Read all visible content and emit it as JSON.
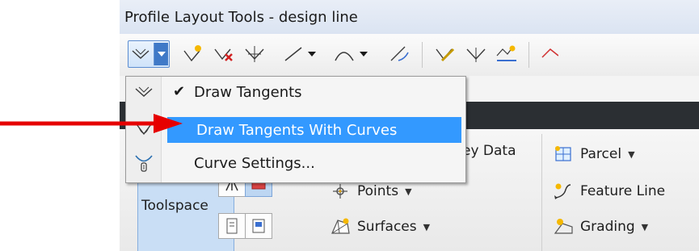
{
  "window": {
    "title": "Profile Layout Tools - design line"
  },
  "toolbar": {
    "buttons": [
      {
        "icon": "draw-tangents-icon"
      },
      {
        "icon": "insert-pvi-icon"
      },
      {
        "icon": "delete-pvi-icon"
      },
      {
        "icon": "move-pvi-icon"
      },
      {
        "icon": "fixed-line-icon"
      },
      {
        "icon": "curve-icon"
      },
      {
        "icon": "free-curve-icon"
      },
      {
        "icon": "insert-pvis-tabular-icon"
      },
      {
        "icon": "raise-lower-pvis-icon"
      },
      {
        "icon": "copy-profile-icon"
      },
      {
        "icon": "profile-grid-view-icon"
      }
    ]
  },
  "menu": {
    "items": [
      {
        "label": "Draw Tangents",
        "checked": true,
        "icon": "draw-tangents-icon"
      },
      {
        "label": "Draw Tangents With Curves",
        "checked": false,
        "highlighted": true,
        "icon": "draw-tangents-curves-icon"
      },
      {
        "label": "Curve Settings...",
        "checked": false,
        "icon": "curve-settings-icon"
      }
    ],
    "check_mark": "✔"
  },
  "ribbon": {
    "toolspace_label": "Toolspace",
    "partial_label": "ey Data",
    "items": [
      {
        "label": "Points",
        "icon": "points-icon",
        "has_dropdown": true
      },
      {
        "label": "Surfaces",
        "icon": "surfaces-icon",
        "has_dropdown": true
      },
      {
        "label": "Parcel",
        "icon": "parcel-icon",
        "has_dropdown": true
      },
      {
        "label": "Feature Line",
        "icon": "feature-line-icon",
        "has_dropdown": false
      },
      {
        "label": "Grading",
        "icon": "grading-icon",
        "has_dropdown": true
      }
    ],
    "dropdown_caret": "▼"
  },
  "colors": {
    "highlight": "#3399ff",
    "arrow": "#e60000",
    "ribbon_dark": "#2b2f33",
    "toolspace_bg": "#c9def5"
  }
}
